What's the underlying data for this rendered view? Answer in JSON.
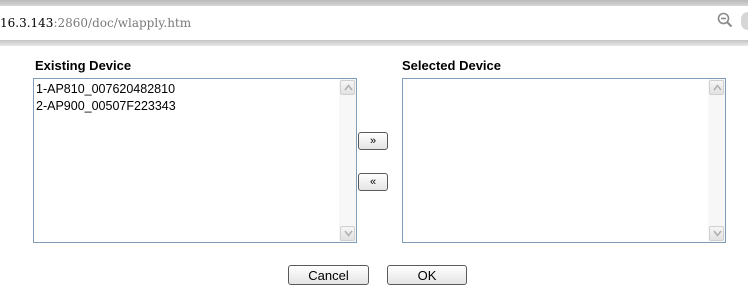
{
  "browser": {
    "url_prefix": "16.3.143",
    "url_rest": ":2860/doc/wlapply.htm",
    "zoom_icon": "magnifier-minus-icon"
  },
  "existing": {
    "label": "Existing Device",
    "items": [
      "1-AP810_007620482810",
      "2-AP900_00507F223343"
    ]
  },
  "selected": {
    "label": "Selected Device",
    "items": []
  },
  "transfer": {
    "add_label": "»",
    "remove_label": "«"
  },
  "actions": {
    "cancel_label": "Cancel",
    "ok_label": "OK"
  }
}
